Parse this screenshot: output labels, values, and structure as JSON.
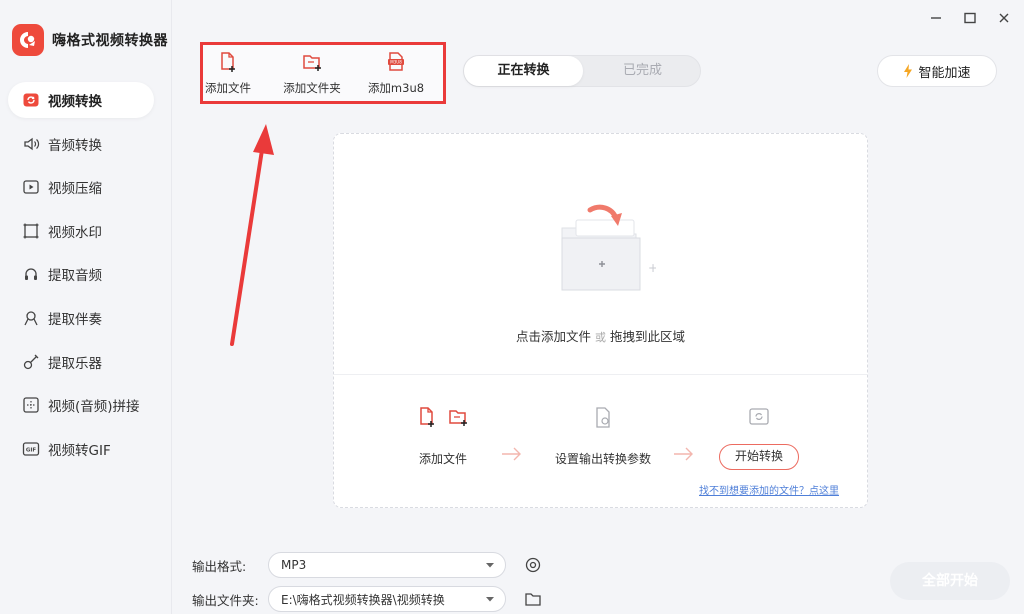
{
  "app": {
    "title": "嗨格式视频转换器"
  },
  "sidebar": {
    "items": [
      {
        "label": "视频转换",
        "icon": "video-convert-icon",
        "active": true
      },
      {
        "label": "音频转换",
        "icon": "audio-icon"
      },
      {
        "label": "视频压缩",
        "icon": "compress-icon"
      },
      {
        "label": "视频水印",
        "icon": "watermark-icon"
      },
      {
        "label": "提取音频",
        "icon": "extract-audio-icon"
      },
      {
        "label": "提取伴奏",
        "icon": "accompaniment-icon"
      },
      {
        "label": "提取乐器",
        "icon": "guitar-icon"
      },
      {
        "label": "视频(音频)拼接",
        "icon": "merge-icon"
      },
      {
        "label": "视频转GIF",
        "icon": "gif-icon"
      }
    ]
  },
  "toolbar": {
    "add_file": "添加文件",
    "add_folder": "添加文件夹",
    "add_m3u8": "添加m3u8"
  },
  "tabs": {
    "converting": "正在转换",
    "done": "已完成"
  },
  "speed": {
    "label": "智能加速"
  },
  "drop": {
    "text_a": "点击添加文件",
    "or": "或",
    "text_b": "拖拽到此区域"
  },
  "steps": {
    "add": "添加文件",
    "params": "设置输出转换参数",
    "start": "开始转换"
  },
  "help_link": "找不到想要添加的文件？点这里",
  "output": {
    "format_label": "输出格式:",
    "format_value": "MP3",
    "folder_label": "输出文件夹:",
    "folder_value": "E:\\嗨格式视频转换器\\视频转换"
  },
  "start_all": "全部开始",
  "colors": {
    "accent": "#ee4a3c",
    "highlight_box": "#ea3a3a",
    "link": "#4f7fd8"
  }
}
